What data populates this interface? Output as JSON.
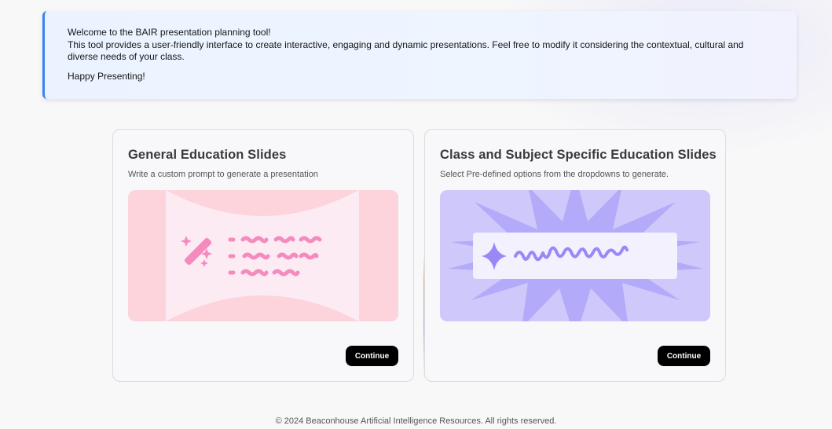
{
  "banner": {
    "line1": "Welcome to the BAIR presentation planning tool!",
    "line2": "This tool provides a user-friendly interface to create interactive, engaging and dynamic presentations. Feel free to modify it considering the contextual, cultural and diverse needs of your class.",
    "line3": "Happy Presenting!",
    "accent_color": "#3b82f6"
  },
  "cards": [
    {
      "title": "General Education Slides",
      "subtitle": "Write a custom prompt to generate a presentation",
      "illustration": "magic-wand-text-illustration",
      "button_label": "Continue"
    },
    {
      "title": "Class and Subject Specific Education Slides",
      "subtitle": "Select Pre-defined options from the dropdowns to generate.",
      "illustration": "sparkle-starburst-illustration",
      "button_label": "Continue"
    }
  ],
  "footer": {
    "text": "© 2024 Beaconhouse Artificial Intelligence Resources. All rights reserved."
  },
  "colors": {
    "button_bg": "#000000",
    "left_illustration_bg": "#fdd4dc",
    "right_illustration_bg": "#cec8fb",
    "right_starburst": "#b3aaf9"
  }
}
